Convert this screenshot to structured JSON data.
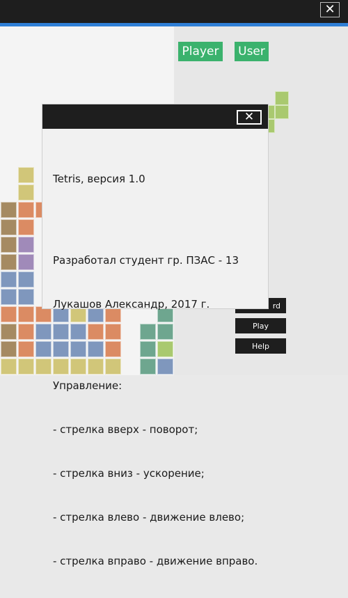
{
  "window": {
    "close_icon": "close-icon"
  },
  "colors": {
    "titlebar": "#1e1e1e",
    "accent": "#2f7fd6",
    "green": "#3bb26d",
    "tetromino_colors": [
      "#a58a62",
      "#db8b63",
      "#a08ab9",
      "#7f97bd",
      "#d1c679",
      "#6ea68f",
      "#a9c96f"
    ]
  },
  "header": {
    "player_label": "Player",
    "user_label": "User"
  },
  "buttons": {
    "record_label": "rd",
    "play_label": "Play",
    "help_label": "Help"
  },
  "dialog": {
    "close_icon": "close-icon",
    "title_line": "Tetris, версия 1.0",
    "author_line1": "Разработал студент гр. ПЗАС - 13",
    "author_line2": "Лукашов Александр, 2017 г.",
    "controls_heading": "Управление:",
    "controls": [
      "- стрелка вверх - поворот;",
      "- стрелка вниз - ускорение;",
      "- стрелка влево - движение влево;",
      "- стрелка вправо - движение вправо."
    ]
  }
}
